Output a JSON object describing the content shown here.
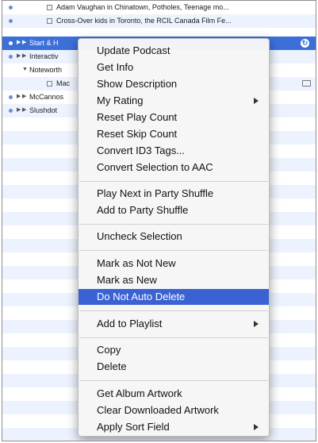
{
  "podcast_rows": [
    {
      "text": "Adam Vaughan in Chinatown, Potholes, Teenage mo..."
    },
    {
      "text": "Cross-Over kids in Toronto, the RCIL Canada Film Fe..."
    },
    {
      "text": "Start & H"
    },
    {
      "text": "Interactiv"
    },
    {
      "text": "Noteworth"
    },
    {
      "text": "Mac"
    },
    {
      "text": "McCannos"
    },
    {
      "text": "Slushdot"
    }
  ],
  "context_menu": {
    "items": [
      {
        "label": "Update Podcast"
      },
      {
        "label": "Get Info"
      },
      {
        "label": "Show Description"
      },
      {
        "label": "My Rating"
      },
      {
        "label": "Reset Play Count"
      },
      {
        "label": "Reset Skip Count"
      },
      {
        "label": "Convert ID3 Tags..."
      },
      {
        "label": "Convert Selection to AAC"
      },
      {
        "label": "Play Next in Party Shuffle"
      },
      {
        "label": "Add to Party Shuffle"
      },
      {
        "label": "Uncheck Selection"
      },
      {
        "label": "Mark as Not New"
      },
      {
        "label": "Mark as New"
      },
      {
        "label": "Do Not Auto Delete"
      },
      {
        "label": "Add to Playlist"
      },
      {
        "label": "Copy"
      },
      {
        "label": "Delete"
      },
      {
        "label": "Get Album Artwork"
      },
      {
        "label": "Clear Downloaded Artwork"
      },
      {
        "label": "Apply Sort Field"
      }
    ]
  }
}
